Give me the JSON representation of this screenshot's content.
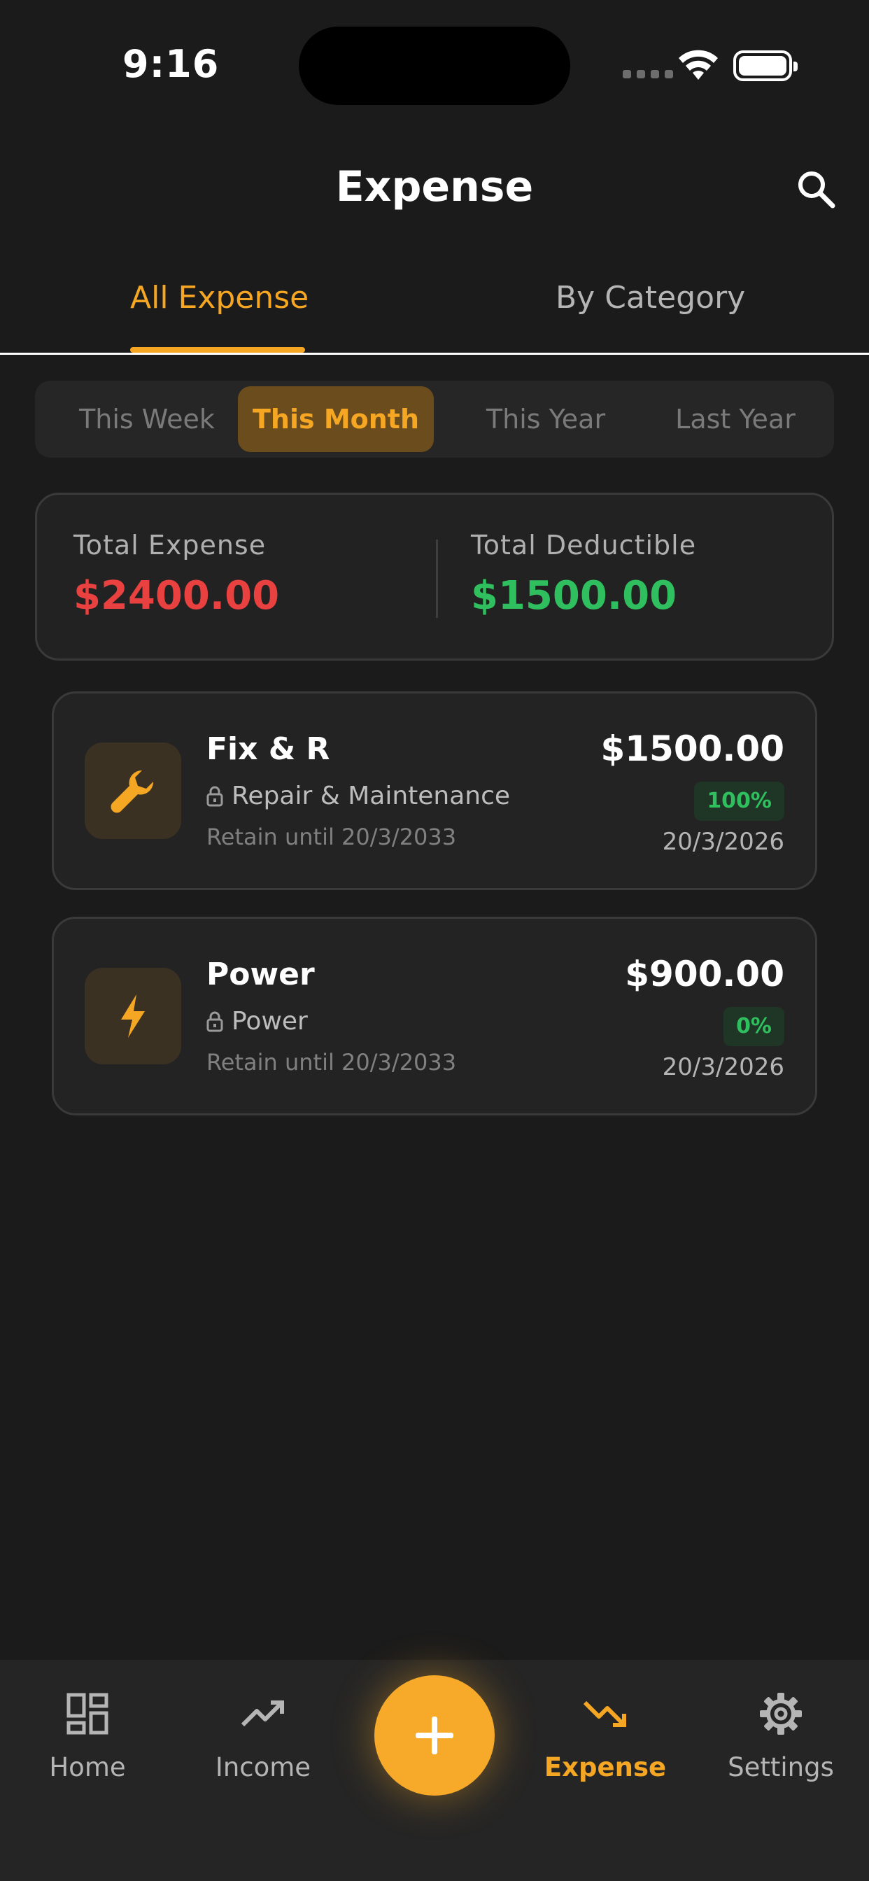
{
  "status_bar": {
    "time": "9:16"
  },
  "header": {
    "title": "Expense"
  },
  "tabs": [
    {
      "label": "All Expense",
      "active": true
    },
    {
      "label": "By Category",
      "active": false
    }
  ],
  "periods": [
    {
      "label": "This Week",
      "active": false
    },
    {
      "label": "This Month",
      "active": true
    },
    {
      "label": "This Year",
      "active": false
    },
    {
      "label": "Last Year",
      "active": false
    }
  ],
  "summary": {
    "total_expense_label": "Total Expense",
    "total_expense_value": "$2400.00",
    "total_deductible_label": "Total Deductible",
    "total_deductible_value": "$1500.00"
  },
  "expenses": [
    {
      "title": "Fix & R",
      "category": "Repair & Maintenance",
      "retain": "Retain until 20/3/2033",
      "amount": "$1500.00",
      "deductible": "100%",
      "date": "20/3/2026",
      "icon": "wrench-icon"
    },
    {
      "title": "Power",
      "category": "Power",
      "retain": "Retain until 20/3/2033",
      "amount": "$900.00",
      "deductible": "0%",
      "date": "20/3/2026",
      "icon": "lightning-icon"
    }
  ],
  "nav": {
    "home": "Home",
    "income": "Income",
    "expense": "Expense",
    "settings": "Settings"
  },
  "colors": {
    "accent": "#f5a623",
    "expense_red": "#e94040",
    "deductible_green": "#2fbf5e",
    "background": "#1b1b1b"
  }
}
